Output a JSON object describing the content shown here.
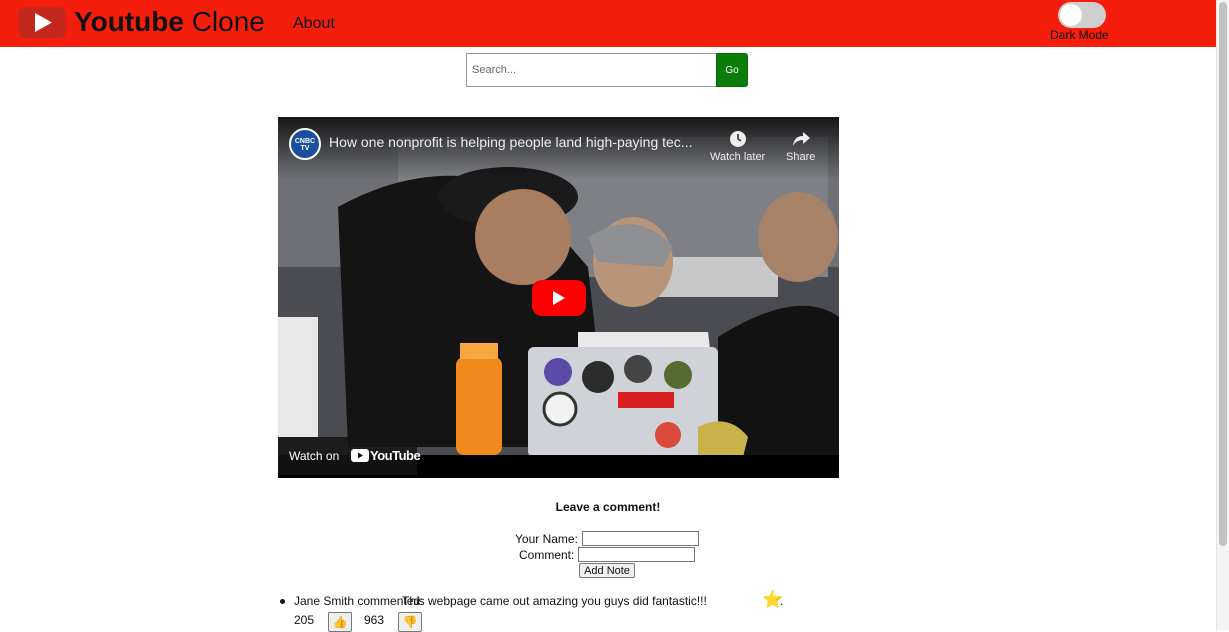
{
  "header": {
    "brand_bold": "Youtube",
    "brand_rest": " Clone",
    "nav_about": "About",
    "dark_mode_label": "Dark Mode",
    "dark_mode_on": false,
    "brand_color": "#f51e0c"
  },
  "search": {
    "placeholder": "Search...",
    "value": "",
    "button_label": "Go"
  },
  "video": {
    "channel_avatar_text": "CNBC TV",
    "title": "How one nonprofit is helping people land high-paying tec...",
    "watch_later_label": "Watch later",
    "share_label": "Share",
    "watch_on_label": "Watch on",
    "youtube_word": "YouTube"
  },
  "comment_form": {
    "heading": "Leave a comment!",
    "name_label": "Your Name:",
    "comment_label": "Comment:",
    "name_value": "",
    "comment_value": "",
    "submit_label": "Add Note"
  },
  "comments": [
    {
      "author": "Jane Smith commented:",
      "text": "This webpage came out amazing you guys did fantastic!!!",
      "likes": "205",
      "dislikes": "963",
      "like_icon": "👍",
      "dislike_icon": "👎",
      "star": "⭐"
    }
  ]
}
